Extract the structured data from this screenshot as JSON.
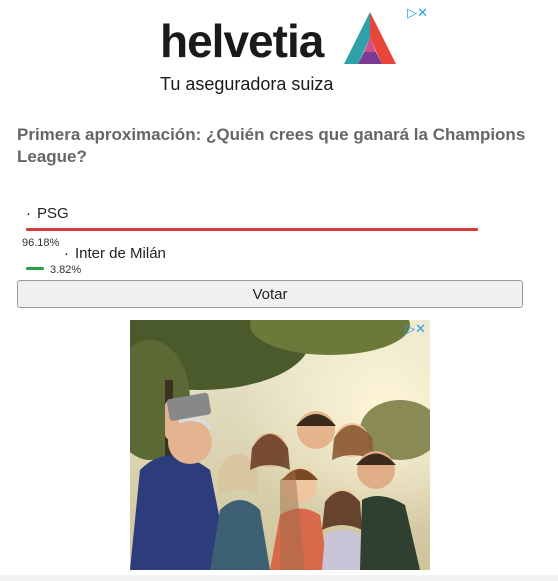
{
  "top_ad": {
    "brand": "helvetia",
    "tagline": "Tu aseguradora suiza",
    "ad_choice": "▷✕"
  },
  "poll": {
    "question": "Primera aproximación: ¿Quién crees que ganará la Champions League?",
    "options": [
      {
        "label": "PSG",
        "percent_text": "96.18%",
        "percent": 96.18,
        "color": "#d23b33"
      },
      {
        "label": "Inter de Milán",
        "percent_text": "3.82%",
        "percent": 3.82,
        "color": "#27a045"
      }
    ],
    "vote_label": "Votar"
  },
  "bottom_ad": {
    "ad_choice": "▷✕"
  }
}
